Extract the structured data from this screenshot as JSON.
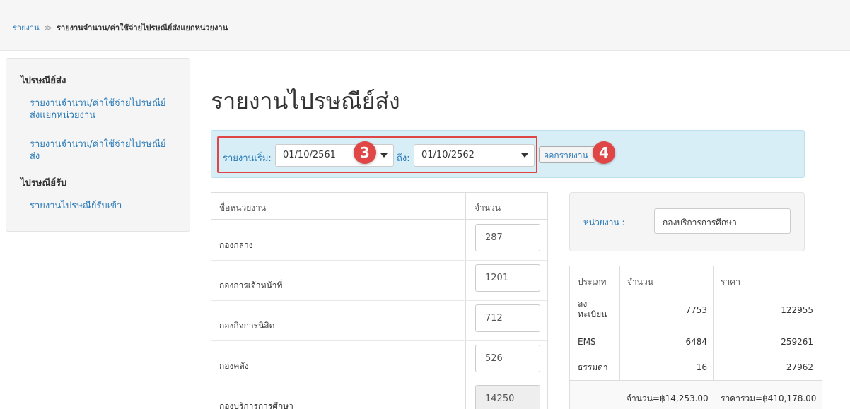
{
  "breadcrumb": {
    "root": "รายงาน",
    "separator": "≫",
    "current": "รายงานจำนวน/ค่าใช้จ่ายไปรษณีย์ส่งแยกหน่วยงาน"
  },
  "sidebar": {
    "sections": [
      {
        "heading": "ไปรษณีย์ส่ง",
        "items": [
          {
            "label_line1": "รายงานจำนวน/ค่าใช้จ่ายไปรษณีย์",
            "label_line2": "ส่งแยกหน่วยงาน"
          },
          {
            "label_line1": "รายงานจำนวน/ค่าใช้จ่ายไปรษณีย์",
            "label_line2": "ส่ง"
          }
        ]
      },
      {
        "heading": "ไปรษณีย์รับ",
        "items": [
          {
            "label_line1": "รายงานไปรษณีย์รับเข้า"
          }
        ]
      }
    ]
  },
  "page_title": "รายงานไปรษณีย์ส่ง",
  "filter": {
    "start_label": "รายงานเริ่ม:",
    "start_value": "01/10/2561",
    "end_label": "ถึง:",
    "end_value": "01/10/2562",
    "submit_label": "ออกรายงาน"
  },
  "annotations": {
    "step_3": "3",
    "step_4": "4",
    "highlight_color": "#e04545"
  },
  "units_table": {
    "columns": [
      "ชื่อหน่วยงาน",
      "จำนวน"
    ],
    "rows": [
      {
        "name": "กองกลาง",
        "count": "287"
      },
      {
        "name": "กองการเจ้าหน้าที่",
        "count": "1201"
      },
      {
        "name": "กองกิจการนิสิต",
        "count": "712"
      },
      {
        "name": "กองคลัง",
        "count": "526"
      },
      {
        "name": "กองบริการการศึกษา",
        "count": "14250"
      }
    ]
  },
  "unit_panel": {
    "label": "หน่วยงาน :",
    "value": "กองบริการการศึกษา"
  },
  "summary_table": {
    "columns": [
      "ประเภท",
      "จำนวน",
      "ราคา"
    ],
    "rows": [
      {
        "type_line1": "ลง",
        "type_line2": "ทะเบียน",
        "count": "7753",
        "price": "122955"
      },
      {
        "type_line1": "EMS",
        "count": "6484",
        "price": "259261"
      },
      {
        "type_line1": "ธรรมดา",
        "count": "16",
        "price": "27962"
      }
    ],
    "total_count": "จำนวน=฿14,253.00",
    "total_price": "ราคารวม=฿410,178.00"
  },
  "colors": {
    "link": "#2a7ab8",
    "filter_bg": "#d8eef7",
    "badge": "#e04646"
  }
}
